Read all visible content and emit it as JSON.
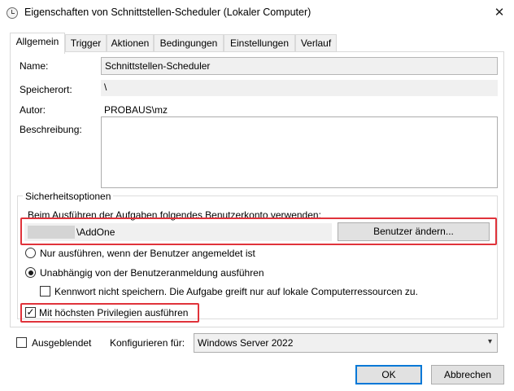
{
  "window": {
    "title": "Eigenschaften von Schnittstellen-Scheduler (Lokaler Computer)",
    "close_glyph": "✕"
  },
  "tabs": [
    {
      "label": "Allgemein",
      "active": true
    },
    {
      "label": "Trigger",
      "active": false
    },
    {
      "label": "Aktionen",
      "active": false
    },
    {
      "label": "Bedingungen",
      "active": false
    },
    {
      "label": "Einstellungen",
      "active": false
    },
    {
      "label": "Verlauf",
      "active": false
    }
  ],
  "general": {
    "name_label": "Name:",
    "name_value": "Schnittstellen-Scheduler",
    "location_label": "Speicherort:",
    "location_value": "\\",
    "author_label": "Autor:",
    "author_value": "PROBAUS\\mz",
    "description_label": "Beschreibung:",
    "description_value": ""
  },
  "security": {
    "group_label": "Sicherheitsoptionen",
    "account_prompt": "Beim Ausführen der Aufgaben folgendes Benutzerkonto verwenden:",
    "account_value": "\\AddOne",
    "change_user_button": "Benutzer ändern...",
    "radio_logged_on": {
      "label": "Nur ausführen, wenn der Benutzer angemeldet ist",
      "checked": false
    },
    "radio_independent": {
      "label": "Unabhängig von der Benutzeranmeldung ausführen",
      "checked": true
    },
    "no_store_password": {
      "label": "Kennwort nicht speichern. Die Aufgabe greift nur auf lokale Computerressourcen zu.",
      "checked": false
    },
    "highest_privileges": {
      "label": "Mit höchsten Privilegien ausführen",
      "checked": true
    },
    "highlight_color": "#e0333b"
  },
  "footer": {
    "hidden_label": "Ausgeblendet",
    "hidden_checked": false,
    "configure_label": "Konfigurieren für:",
    "configure_value": "Windows Server 2022",
    "ok_button": "OK",
    "cancel_button": "Abbrechen"
  },
  "glyphs": {
    "check": "✓",
    "dropdown": "▾"
  }
}
